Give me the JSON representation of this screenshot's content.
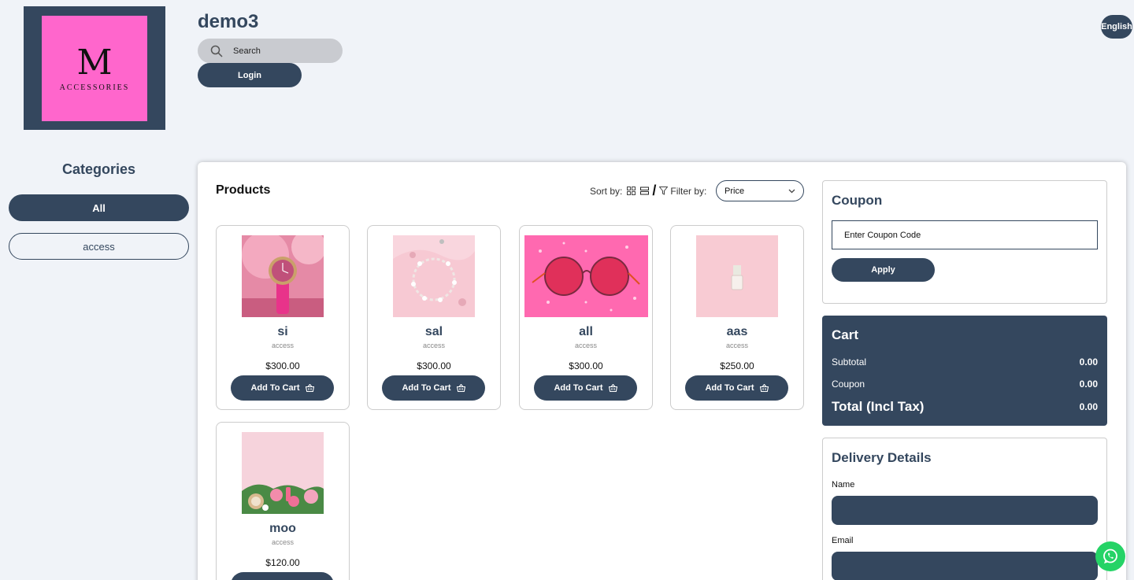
{
  "header": {
    "logo": {
      "letter": "M",
      "text": "ACCESSORIES"
    },
    "store_name": "demo3",
    "search_placeholder": "Search",
    "login_label": "Login",
    "language_label": "English"
  },
  "sidebar": {
    "title": "Categories",
    "items": [
      {
        "label": "All",
        "active": true
      },
      {
        "label": "access",
        "active": false
      }
    ]
  },
  "products": {
    "title": "Products",
    "sort_label": "Sort by:",
    "filter_label": "Filter by:",
    "filter_value": "Price",
    "add_to_cart_label": "Add To Cart",
    "items": [
      {
        "name": "si",
        "category": "access",
        "price": "$300.00",
        "image": "pink-watch"
      },
      {
        "name": "sal",
        "category": "access",
        "price": "$300.00",
        "image": "pearl-bracelet"
      },
      {
        "name": "all",
        "category": "access",
        "price": "$300.00",
        "image": "pink-sunglasses"
      },
      {
        "name": "aas",
        "category": "access",
        "price": "$250.00",
        "image": "nail-polish"
      },
      {
        "name": "moo",
        "category": "access",
        "price": "$120.00",
        "image": "flowers-cosmetics"
      }
    ]
  },
  "coupon": {
    "title": "Coupon",
    "placeholder": "Enter Coupon Code",
    "apply_label": "Apply"
  },
  "cart": {
    "title": "Cart",
    "subtotal_label": "Subtotal",
    "subtotal_value": "0.00",
    "coupon_label": "Coupon",
    "coupon_value": "0.00",
    "total_label": "Total (Incl Tax)",
    "total_value": "0.00"
  },
  "delivery": {
    "title": "Delivery Details",
    "name_label": "Name",
    "email_label": "Email"
  },
  "colors": {
    "primary": "#34475e",
    "logo_bg": "#ff66cc",
    "page_bg": "#f0f3f8",
    "whatsapp": "#25d366"
  }
}
